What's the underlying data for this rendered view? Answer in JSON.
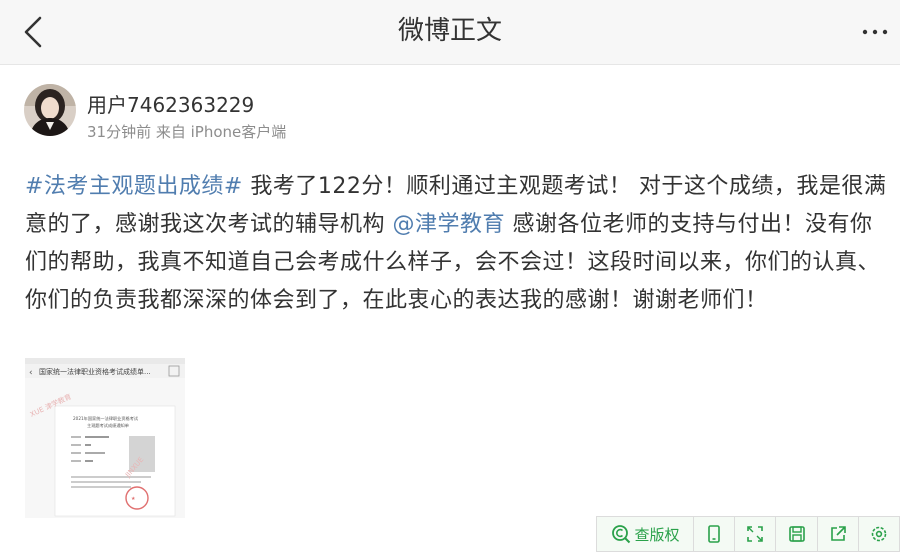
{
  "header": {
    "title": "微博正文",
    "back_icon": "chevron-left-icon",
    "more_icon": "more-horizontal-icon"
  },
  "author": {
    "name": "用户7462363229",
    "time": "31分钟前",
    "source": "来自 iPhone客户端"
  },
  "post": {
    "hashtag": "#法考主观题出成绩#",
    "text_1": " 我考了122分！顺利通过主观题考试！ 对于这个成绩，我是很满意的了，感谢我这次考试的辅导机构 ",
    "mention": "@津学教育",
    "text_2": " 感谢各位老师的支持与付出！没有你们的帮助，我真不知道自己会考成什么样子，会不会过！这段时间以来，你们的认真、你们的负责我都深深的体会到了，在此衷心的表达我的感谢！谢谢老师们！"
  },
  "image": {
    "header_text": "国家统一法律职业资格考试成绩单...",
    "doc_title_1": "2021年国家统一法律职业资格考试",
    "doc_title_2": "主观题考试成绩通知单",
    "watermark": "XUE 津学教育",
    "watermark_2": "JINXUE"
  },
  "toolbar": {
    "copyright_label": "查版权",
    "colors": {
      "accent": "#2aa14a",
      "background": "#f4faf4"
    },
    "icons": [
      "copyright-search-icon",
      "phone-icon",
      "expand-icon",
      "save-icon",
      "share-icon",
      "settings-icon"
    ]
  },
  "colors": {
    "link": "#507daf",
    "text": "#333333",
    "meta": "#8d8d8d",
    "nav_bg": "#f7f7f7"
  }
}
